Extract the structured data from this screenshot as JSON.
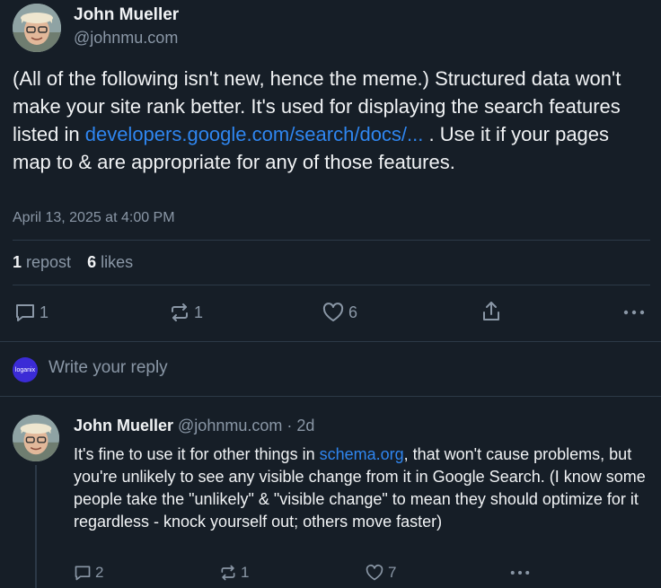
{
  "post": {
    "author_name": "John Mueller",
    "author_handle": "@johnmu.com",
    "text_before_link": "(All of the following isn't new, hence the meme.) Structured data won't make your site rank better. It's used for displaying the search features listed in ",
    "link_text": "developers.google.com/search/docs/...",
    "text_after_link": " . Use it if your pages map to & are appropriate for any of those features.",
    "timestamp": "April 13, 2025 at 4:00 PM",
    "reposts_count": "1",
    "reposts_label": "repost",
    "likes_count": "6",
    "likes_label": "likes",
    "actions": {
      "reply_count": "1",
      "repost_count": "1",
      "like_count": "6"
    }
  },
  "reply_box": {
    "avatar_text": "loganix",
    "placeholder": "Write your reply"
  },
  "reply": {
    "author_name": "John Mueller",
    "author_handle": "@johnmu.com",
    "age": "· 2d",
    "text_before_link": "It's fine to use it for other things in ",
    "link_text": "schema.org",
    "text_after_link": ", that won't cause problems, but you're unlikely to see any visible change from it in Google Search. (I know some people take the \"unlikely\" & \"visible change\" to mean they should optimize for it regardless - knock yourself out; others move faster)",
    "actions": {
      "reply_count": "2",
      "repost_count": "1",
      "like_count": "7"
    }
  },
  "colors": {
    "background": "#161e27",
    "text": "#f1f3f5",
    "muted": "#8a97a6",
    "link": "#2f86f0",
    "divider": "#2c3947",
    "loganix_badge": "#3b2bd6"
  },
  "icons": [
    "avatar",
    "reply-icon",
    "repost-icon",
    "like-icon",
    "share-icon",
    "more-icon"
  ]
}
